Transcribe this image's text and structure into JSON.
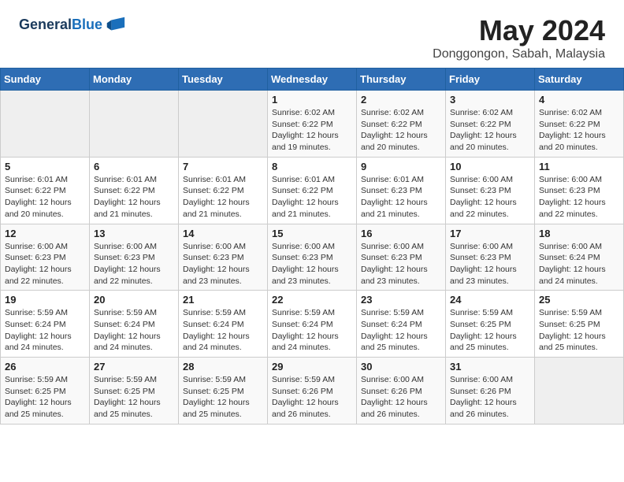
{
  "header": {
    "logo_line1": "General",
    "logo_line2": "Blue",
    "month_year": "May 2024",
    "location": "Donggongon, Sabah, Malaysia"
  },
  "weekdays": [
    "Sunday",
    "Monday",
    "Tuesday",
    "Wednesday",
    "Thursday",
    "Friday",
    "Saturday"
  ],
  "weeks": [
    [
      {
        "day": "",
        "sunrise": "",
        "sunset": "",
        "daylight": ""
      },
      {
        "day": "",
        "sunrise": "",
        "sunset": "",
        "daylight": ""
      },
      {
        "day": "",
        "sunrise": "",
        "sunset": "",
        "daylight": ""
      },
      {
        "day": "1",
        "sunrise": "Sunrise: 6:02 AM",
        "sunset": "Sunset: 6:22 PM",
        "daylight": "Daylight: 12 hours and 19 minutes."
      },
      {
        "day": "2",
        "sunrise": "Sunrise: 6:02 AM",
        "sunset": "Sunset: 6:22 PM",
        "daylight": "Daylight: 12 hours and 20 minutes."
      },
      {
        "day": "3",
        "sunrise": "Sunrise: 6:02 AM",
        "sunset": "Sunset: 6:22 PM",
        "daylight": "Daylight: 12 hours and 20 minutes."
      },
      {
        "day": "4",
        "sunrise": "Sunrise: 6:02 AM",
        "sunset": "Sunset: 6:22 PM",
        "daylight": "Daylight: 12 hours and 20 minutes."
      }
    ],
    [
      {
        "day": "5",
        "sunrise": "Sunrise: 6:01 AM",
        "sunset": "Sunset: 6:22 PM",
        "daylight": "Daylight: 12 hours and 20 minutes."
      },
      {
        "day": "6",
        "sunrise": "Sunrise: 6:01 AM",
        "sunset": "Sunset: 6:22 PM",
        "daylight": "Daylight: 12 hours and 21 minutes."
      },
      {
        "day": "7",
        "sunrise": "Sunrise: 6:01 AM",
        "sunset": "Sunset: 6:22 PM",
        "daylight": "Daylight: 12 hours and 21 minutes."
      },
      {
        "day": "8",
        "sunrise": "Sunrise: 6:01 AM",
        "sunset": "Sunset: 6:22 PM",
        "daylight": "Daylight: 12 hours and 21 minutes."
      },
      {
        "day": "9",
        "sunrise": "Sunrise: 6:01 AM",
        "sunset": "Sunset: 6:23 PM",
        "daylight": "Daylight: 12 hours and 21 minutes."
      },
      {
        "day": "10",
        "sunrise": "Sunrise: 6:00 AM",
        "sunset": "Sunset: 6:23 PM",
        "daylight": "Daylight: 12 hours and 22 minutes."
      },
      {
        "day": "11",
        "sunrise": "Sunrise: 6:00 AM",
        "sunset": "Sunset: 6:23 PM",
        "daylight": "Daylight: 12 hours and 22 minutes."
      }
    ],
    [
      {
        "day": "12",
        "sunrise": "Sunrise: 6:00 AM",
        "sunset": "Sunset: 6:23 PM",
        "daylight": "Daylight: 12 hours and 22 minutes."
      },
      {
        "day": "13",
        "sunrise": "Sunrise: 6:00 AM",
        "sunset": "Sunset: 6:23 PM",
        "daylight": "Daylight: 12 hours and 22 minutes."
      },
      {
        "day": "14",
        "sunrise": "Sunrise: 6:00 AM",
        "sunset": "Sunset: 6:23 PM",
        "daylight": "Daylight: 12 hours and 23 minutes."
      },
      {
        "day": "15",
        "sunrise": "Sunrise: 6:00 AM",
        "sunset": "Sunset: 6:23 PM",
        "daylight": "Daylight: 12 hours and 23 minutes."
      },
      {
        "day": "16",
        "sunrise": "Sunrise: 6:00 AM",
        "sunset": "Sunset: 6:23 PM",
        "daylight": "Daylight: 12 hours and 23 minutes."
      },
      {
        "day": "17",
        "sunrise": "Sunrise: 6:00 AM",
        "sunset": "Sunset: 6:23 PM",
        "daylight": "Daylight: 12 hours and 23 minutes."
      },
      {
        "day": "18",
        "sunrise": "Sunrise: 6:00 AM",
        "sunset": "Sunset: 6:24 PM",
        "daylight": "Daylight: 12 hours and 24 minutes."
      }
    ],
    [
      {
        "day": "19",
        "sunrise": "Sunrise: 5:59 AM",
        "sunset": "Sunset: 6:24 PM",
        "daylight": "Daylight: 12 hours and 24 minutes."
      },
      {
        "day": "20",
        "sunrise": "Sunrise: 5:59 AM",
        "sunset": "Sunset: 6:24 PM",
        "daylight": "Daylight: 12 hours and 24 minutes."
      },
      {
        "day": "21",
        "sunrise": "Sunrise: 5:59 AM",
        "sunset": "Sunset: 6:24 PM",
        "daylight": "Daylight: 12 hours and 24 minutes."
      },
      {
        "day": "22",
        "sunrise": "Sunrise: 5:59 AM",
        "sunset": "Sunset: 6:24 PM",
        "daylight": "Daylight: 12 hours and 24 minutes."
      },
      {
        "day": "23",
        "sunrise": "Sunrise: 5:59 AM",
        "sunset": "Sunset: 6:24 PM",
        "daylight": "Daylight: 12 hours and 25 minutes."
      },
      {
        "day": "24",
        "sunrise": "Sunrise: 5:59 AM",
        "sunset": "Sunset: 6:25 PM",
        "daylight": "Daylight: 12 hours and 25 minutes."
      },
      {
        "day": "25",
        "sunrise": "Sunrise: 5:59 AM",
        "sunset": "Sunset: 6:25 PM",
        "daylight": "Daylight: 12 hours and 25 minutes."
      }
    ],
    [
      {
        "day": "26",
        "sunrise": "Sunrise: 5:59 AM",
        "sunset": "Sunset: 6:25 PM",
        "daylight": "Daylight: 12 hours and 25 minutes."
      },
      {
        "day": "27",
        "sunrise": "Sunrise: 5:59 AM",
        "sunset": "Sunset: 6:25 PM",
        "daylight": "Daylight: 12 hours and 25 minutes."
      },
      {
        "day": "28",
        "sunrise": "Sunrise: 5:59 AM",
        "sunset": "Sunset: 6:25 PM",
        "daylight": "Daylight: 12 hours and 25 minutes."
      },
      {
        "day": "29",
        "sunrise": "Sunrise: 5:59 AM",
        "sunset": "Sunset: 6:26 PM",
        "daylight": "Daylight: 12 hours and 26 minutes."
      },
      {
        "day": "30",
        "sunrise": "Sunrise: 6:00 AM",
        "sunset": "Sunset: 6:26 PM",
        "daylight": "Daylight: 12 hours and 26 minutes."
      },
      {
        "day": "31",
        "sunrise": "Sunrise: 6:00 AM",
        "sunset": "Sunset: 6:26 PM",
        "daylight": "Daylight: 12 hours and 26 minutes."
      },
      {
        "day": "",
        "sunrise": "",
        "sunset": "",
        "daylight": ""
      }
    ]
  ]
}
